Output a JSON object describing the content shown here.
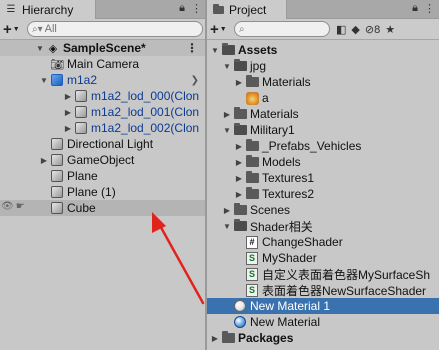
{
  "hierarchy": {
    "tab_title": "Hierarchy",
    "search_placeholder": "All",
    "scene_name": "SampleScene*",
    "items": [
      {
        "label": "Main Camera"
      },
      {
        "label": "m1a2"
      },
      {
        "label": "m1a2_lod_000(Clon"
      },
      {
        "label": "m1a2_lod_001(Clon"
      },
      {
        "label": "m1a2_lod_002(Clon"
      },
      {
        "label": "Directional Light"
      },
      {
        "label": "GameObject"
      },
      {
        "label": "Plane"
      },
      {
        "label": "Plane (1)"
      },
      {
        "label": "Cube"
      }
    ]
  },
  "project": {
    "tab_title": "Project",
    "toolbar_count": "8",
    "items": [
      {
        "label": "Assets"
      },
      {
        "label": "jpg"
      },
      {
        "label": "Materials"
      },
      {
        "label": "a"
      },
      {
        "label": "Materials"
      },
      {
        "label": "Military1"
      },
      {
        "label": "_Prefabs_Vehicles"
      },
      {
        "label": "Models"
      },
      {
        "label": "Textures1"
      },
      {
        "label": "Textures2"
      },
      {
        "label": "Scenes"
      },
      {
        "label": "Shader相关"
      },
      {
        "label": "ChangeShader"
      },
      {
        "label": "MyShader"
      },
      {
        "label": "自定义表面着色器MySurfaceSh"
      },
      {
        "label": "表面着色器NewSurfaceShader"
      },
      {
        "label": "New Material 1"
      },
      {
        "label": "New Material"
      },
      {
        "label": "Packages"
      }
    ]
  },
  "colors": {
    "selection": "#3a72b0",
    "annotation_arrow": "#e0241d",
    "prefab_blue": "#0a3b93"
  }
}
